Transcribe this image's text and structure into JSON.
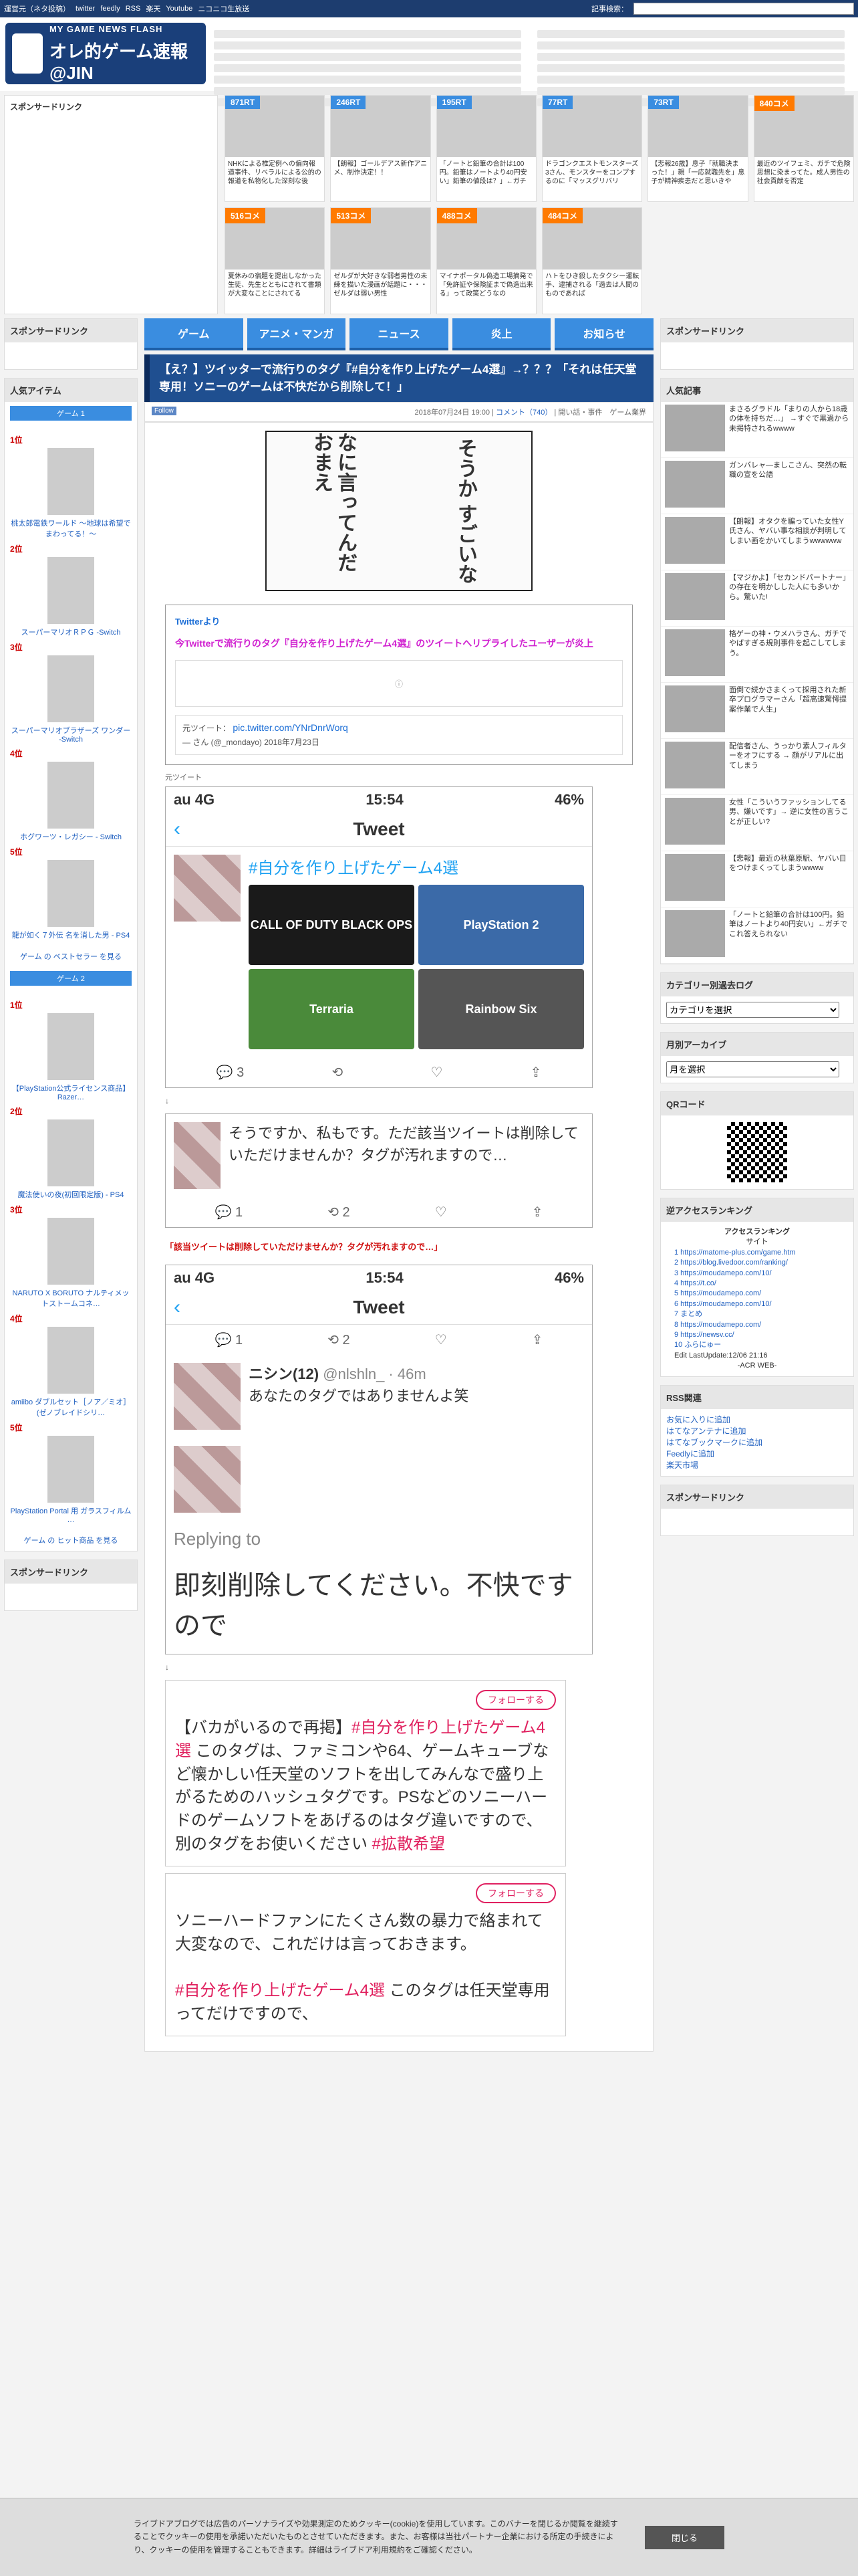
{
  "topbar": {
    "links": [
      "運営元（ネタ投稿）",
      "twitter",
      "feedly",
      "RSS",
      "楽天",
      "Youtube",
      "ニコニコ生放送"
    ],
    "search_label": "記事検索："
  },
  "logo": {
    "sub": "MY GAME NEWS FLASH",
    "title": "オレ的ゲーム速報@JIN"
  },
  "band": {
    "sponsor": "スポンサードリンク",
    "tiles": [
      {
        "badge": "871RT",
        "color": "#3a8de0",
        "text": "NHKによる椎定例への偏向報道事件、リベラルによる公的の報道を私物化した深刻な後"
      },
      {
        "badge": "246RT",
        "color": "#3a8de0",
        "text": "【朗報】ゴールデアス新作アニメ、制作決定！！"
      },
      {
        "badge": "195RT",
        "color": "#3a8de0",
        "text": "「ノートと鉛筆の合計は100円。鉛筆はノートより40円安い」鉛筆の値段は？」←ガチ"
      },
      {
        "badge": "77RT",
        "color": "#3a8de0",
        "text": "ドラゴンクエストモンスターズ3さん、モンスターをコンプするのに「マッスグリバリ"
      },
      {
        "badge": "73RT",
        "color": "#3a8de0",
        "text": "【悲報26歳】息子「就職決まった！」親「一応就職先を」息子が精神疾患だと思いきや"
      },
      {
        "badge": "840コメ",
        "color": "#ff7a00",
        "text": "最近のツイフェミ、ガチで危険思想に染まってた。成人男性の社会貢献を否定"
      },
      {
        "badge": "516コメ",
        "color": "#ff7a00",
        "text": "夏休みの宿題を提出しなかった生徒、先生とともにされて書類が大変なことにされてる"
      },
      {
        "badge": "513コメ",
        "color": "#ff7a00",
        "text": "ゼルダが大好きな弱者男性の未練を描いた漫画が話題に・・・ゼルダは弱い男性"
      },
      {
        "badge": "488コメ",
        "color": "#ff7a00",
        "text": "マイナポータル偽造工場摘発で「免許証や保険証まで偽造出来る」って政策どうなの"
      },
      {
        "badge": "484コメ",
        "color": "#ff7a00",
        "text": "ハトをひき殺したタクシー運転手、逮捕される「過去は人間のものであれば"
      }
    ]
  },
  "left": {
    "sponsor": "スポンサードリンク",
    "popular": "人気アイテム",
    "g1": "ゲーム 1",
    "g2": "ゲーム 2",
    "items1": [
      {
        "rank": "1位",
        "name": "桃太郎電鉄ワールド ～地球は希望でまわってる！～"
      },
      {
        "rank": "2位",
        "name": "スーパーマリオＲＰＧ -Switch"
      },
      {
        "rank": "3位",
        "name": "スーパーマリオブラザーズ ワンダー -Switch"
      },
      {
        "rank": "4位",
        "name": "ホグワーツ・レガシー - Switch"
      },
      {
        "rank": "5位",
        "name": "龍が如く７外伝 名を消した男 - PS4"
      }
    ],
    "more1": "ゲーム の ベストセラー を見る",
    "items2": [
      {
        "rank": "1位",
        "name": "【PlayStation公式ライセンス商品】Razer…"
      },
      {
        "rank": "2位",
        "name": "魔法使いの夜(初回限定版) - PS4"
      },
      {
        "rank": "3位",
        "name": "NARUTO X BORUTO ナルティメットストームコネ…"
      },
      {
        "rank": "4位",
        "name": "amiibo ダブルセット［ノア／ミオ］(ゼノブレイドシリ…"
      },
      {
        "rank": "5位",
        "name": "PlayStation Portal 用 ガラスフィルム …"
      }
    ],
    "more2": "ゲーム の ヒット商品 を見る"
  },
  "nav": [
    "ゲーム",
    "アニメ・マンガ",
    "ニュース",
    "炎上",
    "お知らせ"
  ],
  "article": {
    "title": "【え？】ツイッターで流行りのタグ『#自分を作り上げたゲーム4選』→？？？「それは任天堂専用！ソニーのゲームは不快だから削除して！」",
    "date": "2018年07月24日 19:00",
    "comments": "コメント（740）",
    "tags": "開い話・事件　ゲーム業界",
    "follow": "Follow",
    "manga_right": "そうか すごいな",
    "manga_left": "なに言ってんだ おまえ",
    "src": "Twitterより",
    "tweet_title": "今Twitterで流行りのタグ『自分を作り上げたゲーム4選』のツイートへリプライしたユーザーが炎上",
    "quote_label": "元ツイート：",
    "quote_link": "pic.twitter.com/YNrDnrWorq",
    "quote_by": "— さん (@_mondayo) 2018年7月23日",
    "shot_label": "元ツイート"
  },
  "phone1": {
    "carrier": "au 4G",
    "time": "15:54",
    "battery": "46%",
    "head": "Tweet",
    "hashtag": "#自分を作り上げたゲーム4選",
    "games": [
      "CALL OF DUTY BLACK OPS",
      "PlayStation 2",
      "Terraria",
      "Rainbow Six"
    ],
    "count": "3"
  },
  "reply1": {
    "text": "そうですか、私もです。ただ該当ツイートは削除していただけませんか？タグが汚れますので…",
    "n1": "1",
    "n2": "2"
  },
  "red1": "「該当ツイートは削除していただけませんか？タグが汚れますので…」",
  "phone2": {
    "carrier": "au 4G",
    "time": "15:54",
    "battery": "46%",
    "head": "Tweet",
    "user": "ニシン(12)",
    "handle": "@nlshln_ · 46m",
    "msg": "あなたのタグではありませんよ笑",
    "replying": "Replying to",
    "big": "即刻削除してください。不快ですので"
  },
  "emb1": {
    "follow": "フォローする",
    "t1": "【バカがいるので再掲】",
    "t2": "#自分を作り上げたゲーム4選",
    "t3": "このタグは、ファミコンや64、ゲームキューブなど懐かしい任天堂のソフトを出してみんなで盛り上がるためのハッシュタグです。PSなどのソニーハードのゲームソフトをあげるのはタグ違いですので、別のタグをお使いください",
    "t4": "#拡散希望"
  },
  "emb2": {
    "follow": "フォローする",
    "t1": "ソニーハードファンにたくさん数の暴力で絡まれて大変なので、これだけは言っておきます。",
    "t2": "#自分を作り上げたゲーム4選",
    "t3": "このタグは任天堂専用ってだけですので、"
  },
  "right": {
    "sponsor": "スポンサードリンク",
    "popular": "人気記事",
    "pops": [
      "まさるグラドル「まりの人から18歳の体を持ちだ…」 →すぐで黒過から未掲特されるwwww",
      "ガンバレャ―ましこさん、突然の転職の宣を公語",
      "【朗報】オタクを騙っていた女性Y氏さん、ヤバい事な相談が判明してしまい画をかいてしまうwwwwww",
      "【マジかよ】「セカンドパートナー」の存在を明かしした人にも多いから。驚いた!",
      "格ゲーの神・ウメハラさん、ガチでやばすぎる規則事件を起こしてしまう。",
      "面倒で続かさまくって採用された新卒プログラマーさん「超高速驚愕提案作業で人生」",
      "配信者さん、うっかり素人フィルターをオフにする → 顔がリアルに出てしまう",
      "女性「こういうファッションしてる男、嫌いです」→ 逆に女性の言うことが正しい?",
      "【悲報】最近の秋葉原駅、ヤバい目をつけまくってしまうwwww",
      "「ノートと鉛筆の合計は100円。鉛筆はノートより40円安い」←ガチでこれ答えられない"
    ],
    "cat_title": "カテゴリー別過去ログ",
    "cat_select": "カテゴリを選択",
    "arch_title": "月別アーカイブ",
    "arch_select": "月を選択",
    "qr_title": "QRコード",
    "acr_title": "逆アクセスランキング",
    "acr_head": "アクセスランキング",
    "acr_sub": "サイト",
    "acr_rows": [
      "1 https://matome-plus.com/game.htm",
      "2 https://blog.livedoor.com/ranking/",
      "3 https://moudamepo.com/10/",
      "4 https://t.co/",
      "5 https://moudamepo.com/",
      "6 https://moudamepo.com/10/",
      "7 まとめ",
      "8 https://moudamepo.com/",
      "9 https://newsv.cc/",
      "10 ふらにゅー"
    ],
    "acr_update": "Edit LastUpdate:12/06 21:16",
    "acr_foot": "-ACR WEB-",
    "rss_title": "RSS関連",
    "rss": [
      "お気に入りに追加",
      "はてなアンテナに追加",
      "はてなブックマークに追加",
      "Feedlyに追加",
      "楽天市場"
    ],
    "sponsor2": "スポンサードリンク"
  },
  "cookie": {
    "text": "ライブドアブログでは広告のパーソナライズや効果測定のためクッキー(cookie)を使用しています。このバナーを閉じるか閲覧を継続することでクッキーの使用を承諾いただいたものとさせていただきます。また、お客様は当社パートナー企業における所定の手続きにより、クッキーの使用を管理することもできます。詳細はライブドア利用規約をご確認ください。",
    "button": "閉じる"
  }
}
